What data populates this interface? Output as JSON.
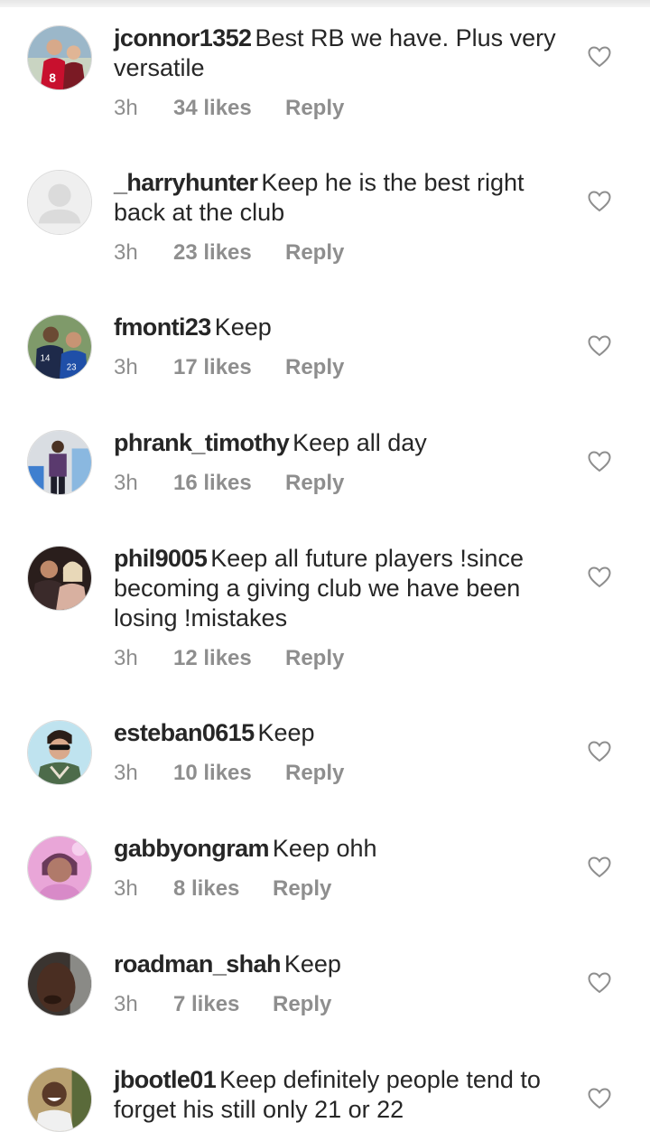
{
  "comments": [
    {
      "username": "jconnor1352",
      "text": "Best RB we have. Plus very versatile",
      "time": "3h",
      "likes": "34 likes",
      "reply": "Reply",
      "avatar": "photo-two-people-red-jersey"
    },
    {
      "username": "_harryhunter",
      "text": "Keep he is the best right back at the club",
      "time": "3h",
      "likes": "23 likes",
      "reply": "Reply",
      "avatar": "default-avatar"
    },
    {
      "username": "fmonti23",
      "text": "Keep",
      "time": "3h",
      "likes": "17 likes",
      "reply": "Reply",
      "avatar": "photo-two-people-football-shirts"
    },
    {
      "username": "phrank_timothy",
      "text": "Keep all day",
      "time": "3h",
      "likes": "16 likes",
      "reply": "Reply",
      "avatar": "photo-person-standing"
    },
    {
      "username": "phil9005",
      "text": "Keep all future players !since becoming a giving club we have been losing !mistakes",
      "time": "3h",
      "likes": "12 likes",
      "reply": "Reply",
      "avatar": "photo-couple"
    },
    {
      "username": "esteban0615",
      "text": "Keep",
      "time": "3h",
      "likes": "10 likes",
      "reply": "Reply",
      "avatar": "photo-man-sunglasses"
    },
    {
      "username": "gabbyongram",
      "text": "Keep ohh",
      "time": "3h",
      "likes": "8 likes",
      "reply": "Reply",
      "avatar": "photo-woman-pink-filter"
    },
    {
      "username": "roadman_shah",
      "text": "Keep",
      "time": "3h",
      "likes": "7 likes",
      "reply": "Reply",
      "avatar": "photo-man-closeup"
    },
    {
      "username": "jbootle01",
      "text": "Keep definitely people tend to forget his still only 21 or 22",
      "time": "",
      "likes": "",
      "reply": "",
      "avatar": "photo-man-smiling"
    }
  ],
  "icons": {
    "like": "heart-outline-icon"
  },
  "colors": {
    "text": "#262626",
    "meta": "#8e8e8e",
    "heart": "#8e8e8e"
  }
}
